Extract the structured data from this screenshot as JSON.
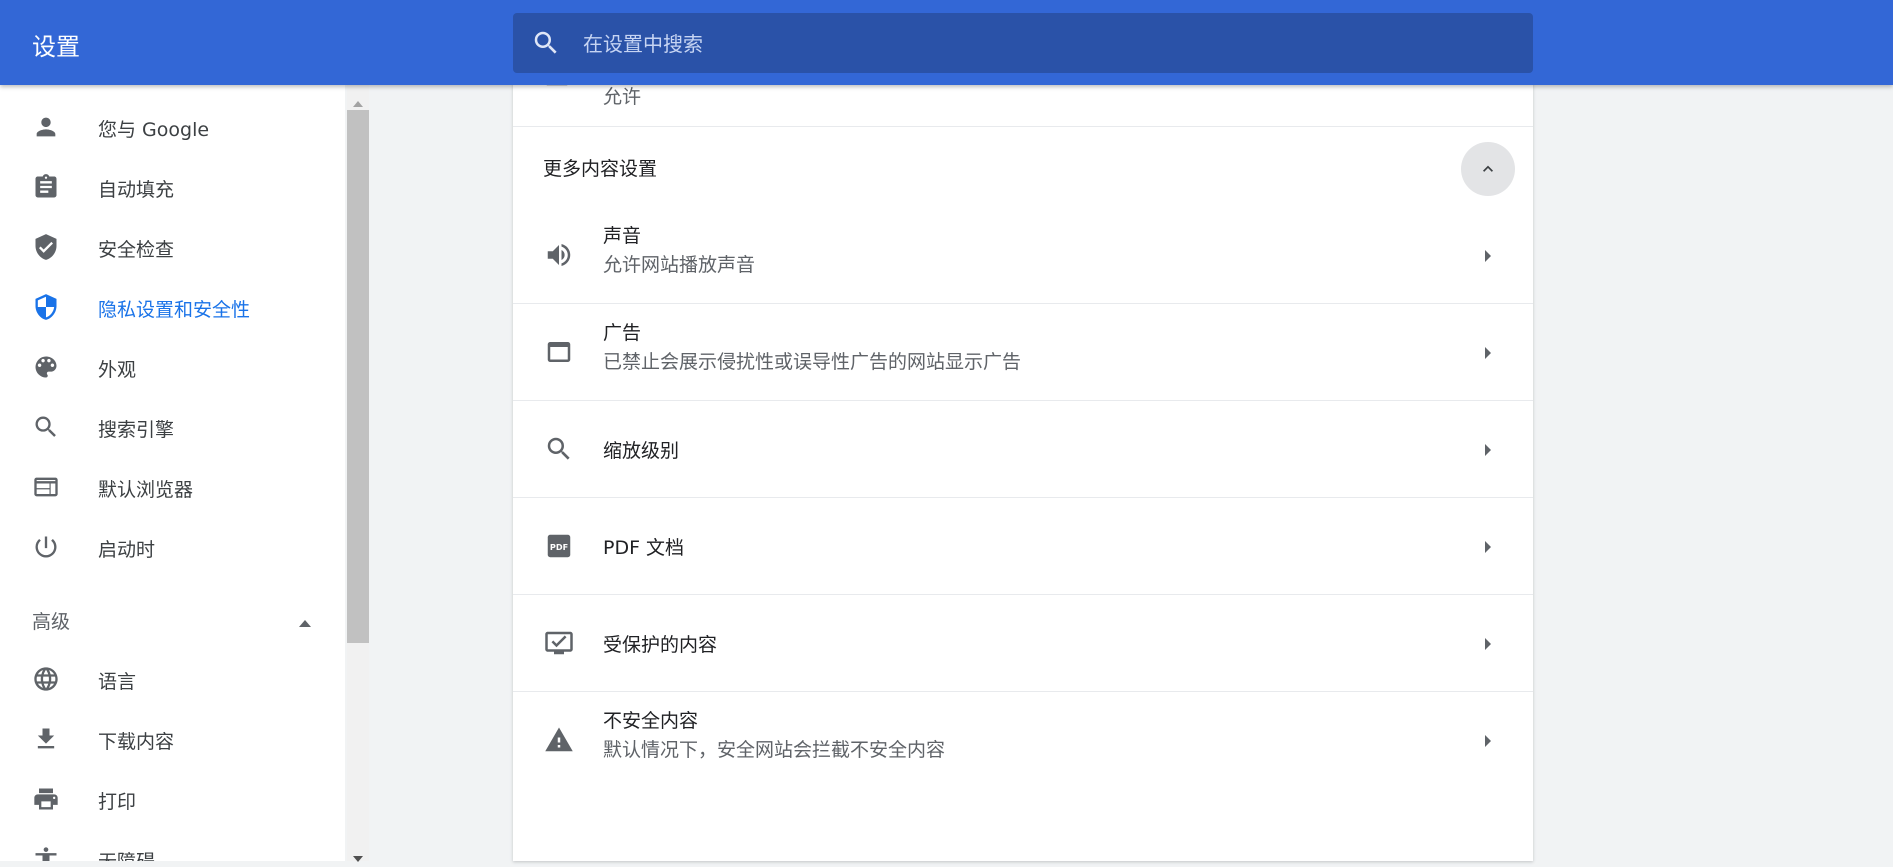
{
  "header": {
    "title": "设置",
    "search_placeholder": "在设置中搜索",
    "search_value": ""
  },
  "sidebar": {
    "items": [
      {
        "label": "您与 Google",
        "icon": "person-icon"
      },
      {
        "label": "自动填充",
        "icon": "clipboard-icon"
      },
      {
        "label": "安全检查",
        "icon": "shield-check-icon"
      },
      {
        "label": "隐私设置和安全性",
        "icon": "shield-icon",
        "active": true
      },
      {
        "label": "外观",
        "icon": "palette-icon"
      },
      {
        "label": "搜索引擎",
        "icon": "search-icon"
      },
      {
        "label": "默认浏览器",
        "icon": "browser-icon"
      },
      {
        "label": "启动时",
        "icon": "power-icon"
      }
    ],
    "advanced": {
      "label": "高级",
      "expanded": true
    },
    "advanced_items": [
      {
        "label": "语言",
        "icon": "globe-icon"
      },
      {
        "label": "下载内容",
        "icon": "download-icon"
      },
      {
        "label": "打印",
        "icon": "printer-icon"
      },
      {
        "label": "无障碍",
        "icon": "accessibility-icon"
      }
    ]
  },
  "content": {
    "top_row_status": "允许",
    "more_settings_title": "更多内容设置",
    "rows": [
      {
        "title": "声音",
        "subtitle": "允许网站播放声音",
        "icon": "sound-icon"
      },
      {
        "title": "广告",
        "subtitle": "已禁止会展示侵扰性或误导性广告的网站显示广告",
        "icon": "ads-icon"
      },
      {
        "title": "缩放级别",
        "subtitle": "",
        "icon": "zoom-icon"
      },
      {
        "title": "PDF 文档",
        "subtitle": "",
        "icon": "pdf-icon"
      },
      {
        "title": "受保护的内容",
        "subtitle": "",
        "icon": "protected-content-icon"
      },
      {
        "title": "不安全内容",
        "subtitle": "默认情况下，安全网站会拦截不安全内容",
        "icon": "warning-icon"
      }
    ]
  },
  "colors": {
    "header_bg": "#3367d6",
    "search_bg": "#2a52a8",
    "accent": "#1a73e8",
    "icon_gray": "#5f6368"
  }
}
